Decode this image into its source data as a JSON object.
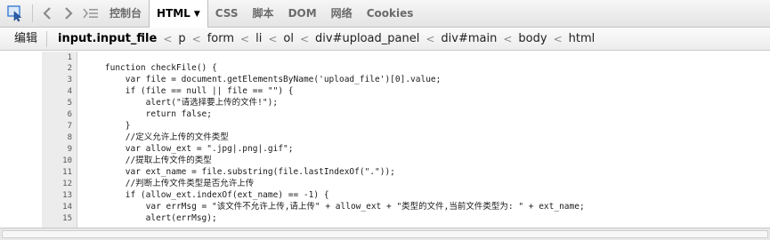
{
  "toolbar": {
    "tabs": [
      {
        "label": "控制台",
        "active": false
      },
      {
        "label": "HTML",
        "active": true
      },
      {
        "label": "CSS",
        "active": false
      },
      {
        "label": "脚本",
        "active": false
      },
      {
        "label": "DOM",
        "active": false
      },
      {
        "label": "网络",
        "active": false
      },
      {
        "label": "Cookies",
        "active": false
      }
    ],
    "icons": [
      "inspect-icon",
      "back-arrow-icon",
      "forward-arrow-icon",
      "console-mode-icon",
      "dropdown-caret-icon"
    ],
    "accent_color": "#3a7bd5"
  },
  "breadcrumb": {
    "edit_label": "编辑",
    "items": [
      "input.input_file",
      "p",
      "form",
      "li",
      "ol",
      "div#upload_panel",
      "div#main",
      "body",
      "html"
    ]
  },
  "code": {
    "lines": [
      {
        "n": "1",
        "text": ""
      },
      {
        "n": "2",
        "text": "    function checkFile() {"
      },
      {
        "n": "3",
        "text": "        var file = document.getElementsByName('upload_file')[0].value;"
      },
      {
        "n": "4",
        "text": "        if (file == null || file == \"\") {"
      },
      {
        "n": "5",
        "text": "            alert(\"请选择要上传的文件!\");"
      },
      {
        "n": "6",
        "text": "            return false;"
      },
      {
        "n": "7",
        "text": "        }"
      },
      {
        "n": "8",
        "text": "        //定义允许上传的文件类型"
      },
      {
        "n": "9",
        "text": "        var allow_ext = \".jpg|.png|.gif\";"
      },
      {
        "n": "10",
        "text": "        //提取上传文件的类型"
      },
      {
        "n": "11",
        "text": "        var ext_name = file.substring(file.lastIndexOf(\".\"));"
      },
      {
        "n": "12",
        "text": "        //判断上传文件类型是否允许上传"
      },
      {
        "n": "13",
        "text": "        if (allow_ext.indexOf(ext_name) == -1) {"
      },
      {
        "n": "14",
        "text": "            var errMsg = \"该文件不允许上传,请上传\" + allow_ext + \"类型的文件,当前文件类型为: \" + ext_name;"
      },
      {
        "n": "15",
        "text": "            alert(errMsg);"
      }
    ]
  }
}
